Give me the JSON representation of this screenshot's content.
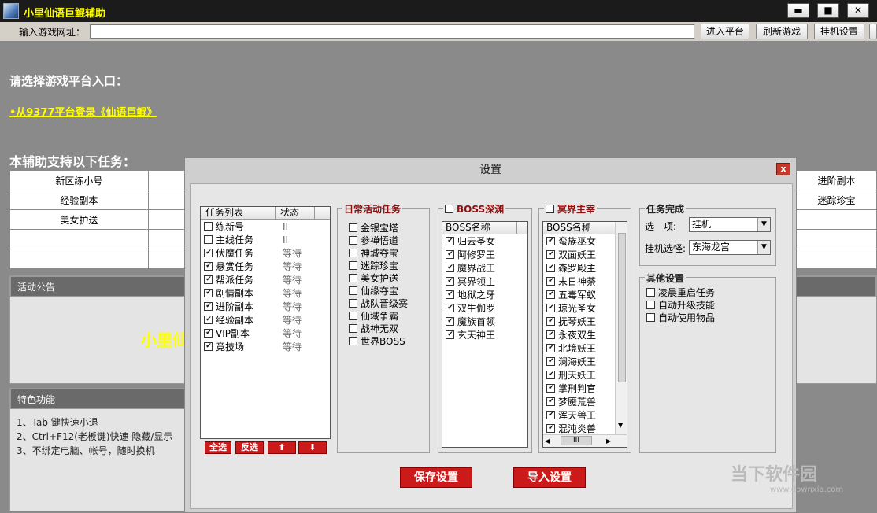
{
  "window": {
    "title": "小里仙语巨鲲辅助",
    "min": "▬",
    "max": "■",
    "close": "✕"
  },
  "toolbar": {
    "url_label": "输入游戏网址：",
    "url_value": "",
    "enter_platform": "进入平台",
    "refresh_game": "刷新游戏",
    "idle_settings": "挂机设置"
  },
  "main": {
    "choose_platform": "请选择游戏平台入口：",
    "entry_link": "•从9377平台登录《仙语巨鲲》",
    "supported_tasks": "本辅助支持以下任务：",
    "task_table": [
      [
        "新区练小号",
        "",
        "",
        "",
        "进阶副本"
      ],
      [
        "经验副本",
        "",
        "",
        "",
        "迷踪珍宝"
      ],
      [
        "美女护送",
        "",
        "",
        "",
        ""
      ],
      [
        "",
        "",
        "",
        "",
        ""
      ],
      [
        "",
        "",
        "",
        "",
        ""
      ]
    ],
    "notice_header": "活动公告",
    "notice_text": "小里仙",
    "features_header": "特色功能",
    "features": [
      "1、Tab 键快速小退",
      "2、Ctrl+F12(老板键)快速 隐藏/显示",
      "3、不绑定电脑、帐号，随时换机"
    ]
  },
  "dialog": {
    "title": "设置",
    "close": "x",
    "task_list": {
      "col_task": "任务列表",
      "col_status": "状态",
      "items": [
        {
          "name": "练新号",
          "checked": false,
          "status": "II"
        },
        {
          "name": "主线任务",
          "checked": false,
          "status": "II"
        },
        {
          "name": "伏魔任务",
          "checked": true,
          "status": "等待"
        },
        {
          "name": "悬赏任务",
          "checked": true,
          "status": "等待"
        },
        {
          "name": "帮派任务",
          "checked": true,
          "status": "等待"
        },
        {
          "name": "剧情副本",
          "checked": true,
          "status": "等待"
        },
        {
          "name": "进阶副本",
          "checked": true,
          "status": "等待"
        },
        {
          "name": "经验副本",
          "checked": true,
          "status": "等待"
        },
        {
          "name": "VIP副本",
          "checked": true,
          "status": "等待"
        },
        {
          "name": "竞技场",
          "checked": true,
          "status": "等待"
        }
      ]
    },
    "task_buttons": {
      "select_all": "全选",
      "invert": "反选",
      "up": "⬆",
      "down": "⬇"
    },
    "daily": {
      "title": "日常活动任务",
      "items": [
        "金银宝塔",
        "参禅悟道",
        "神城夺宝",
        "迷踪珍宝",
        "美女护送",
        "仙缘夺宝",
        "战队晋级赛",
        "仙域争霸",
        "战神无双",
        "世界BOSS"
      ]
    },
    "boss_abyss": {
      "title": "BOSS深渊",
      "header": "BOSS名称",
      "items": [
        "归云圣女",
        "阿修罗王",
        "魔界战王",
        "冥界领主",
        "地狱之牙",
        "双生伽罗",
        "魔族首领",
        "玄天神王"
      ]
    },
    "netherworld": {
      "title": "冥界主宰",
      "header": "BOSS名称",
      "items": [
        "蛮族巫女",
        "双面妖王",
        "森罗殿主",
        "末日神荼",
        "五毒军蚁",
        "琼光圣女",
        "抚琴妖王",
        "永夜双生",
        "北境妖王",
        "澜海妖王",
        "刑天妖王",
        "掌刑判官",
        "梦魇荒兽",
        "浑天兽王",
        "混沌炎兽"
      ],
      "scroll_h": "III"
    },
    "task_complete": {
      "title": "任务完成",
      "option_label": "选　项:",
      "option_value": "挂机",
      "idle_label": "挂机选怪:",
      "idle_value": "东海龙宫"
    },
    "other": {
      "title": "其他设置",
      "items": [
        "凌晨重启任务",
        "自动升级技能",
        "自动使用物品"
      ]
    },
    "save": "保存设置",
    "import": "导入设置"
  },
  "watermark": {
    "text": "当下软件园",
    "url": "www.downxia.com"
  }
}
